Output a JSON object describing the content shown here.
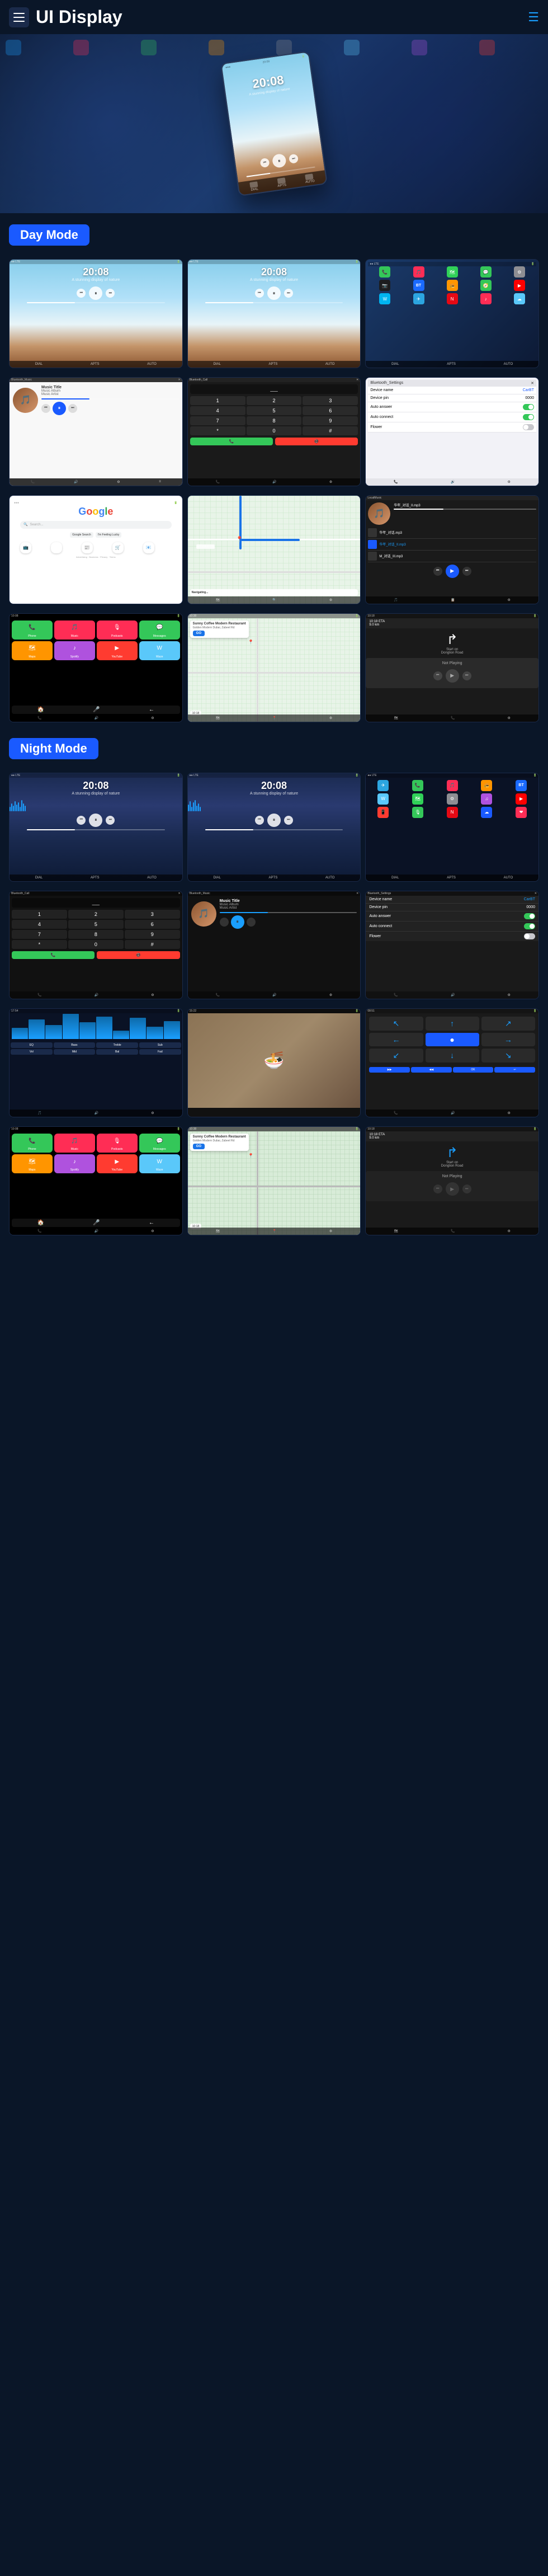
{
  "header": {
    "menu_icon": "☰",
    "title": "UI Display",
    "hamburger": "≡"
  },
  "hero": {
    "time": "20:08",
    "subtitle": "A stunning display of nature"
  },
  "day_mode": {
    "label": "Day Mode"
  },
  "night_mode": {
    "label": "Night Mode"
  },
  "screens": {
    "music_time": "20:08",
    "music_subtitle": "A stunning display of nature",
    "bt_music": "Bluetooth_Music",
    "bt_call": "Bluetooth_Call",
    "bt_settings": "Bluetooth_Settings",
    "music_title": "Music Title",
    "music_album": "Music Album",
    "music_artist": "Music Artist",
    "device_name_label": "Device name",
    "device_name_val": "CarBT",
    "device_pin_label": "Device pin",
    "device_pin_val": "0000",
    "auto_answer_label": "Auto answer",
    "auto_connect_label": "Auto connect",
    "flower_label": "Flower",
    "google_text": "Google",
    "search_placeholder": "Search...",
    "local_music": "LocalMusic",
    "sunny_coffee": "Sunny Coffee Modern Restaurant",
    "sunny_address": "Golden Modern Dubai, Zabeel Rd",
    "eta_label": "10:18 ETA",
    "distance_label": "9.0 km",
    "go_label": "GO",
    "time_bottom": "10:18",
    "not_playing": "Not Playing",
    "start_on": "Start on",
    "donglion": "Donglion Road",
    "map_labels": [
      "E Costner Ln",
      ""
    ],
    "call_digits": [
      "1",
      "2",
      "3",
      "4",
      "5",
      "6",
      "7",
      "8",
      "9",
      "*",
      "0",
      "#"
    ],
    "bottom_nav": [
      "DIAL",
      "APTS",
      "AUTO"
    ],
    "song1": "华年_对话.mp3",
    "song2": "华年_对话_II.mp3",
    "song3": "M_对话_III.mp3"
  },
  "colors": {
    "accent_blue": "#1a5aff",
    "day_sky": "#87ceeb",
    "night_sky": "#1a2a50",
    "google_blue": "#4285f4",
    "google_red": "#ea4335",
    "google_yellow": "#fbbc05",
    "google_green": "#34a853",
    "nav_blue": "#1a73e8"
  }
}
